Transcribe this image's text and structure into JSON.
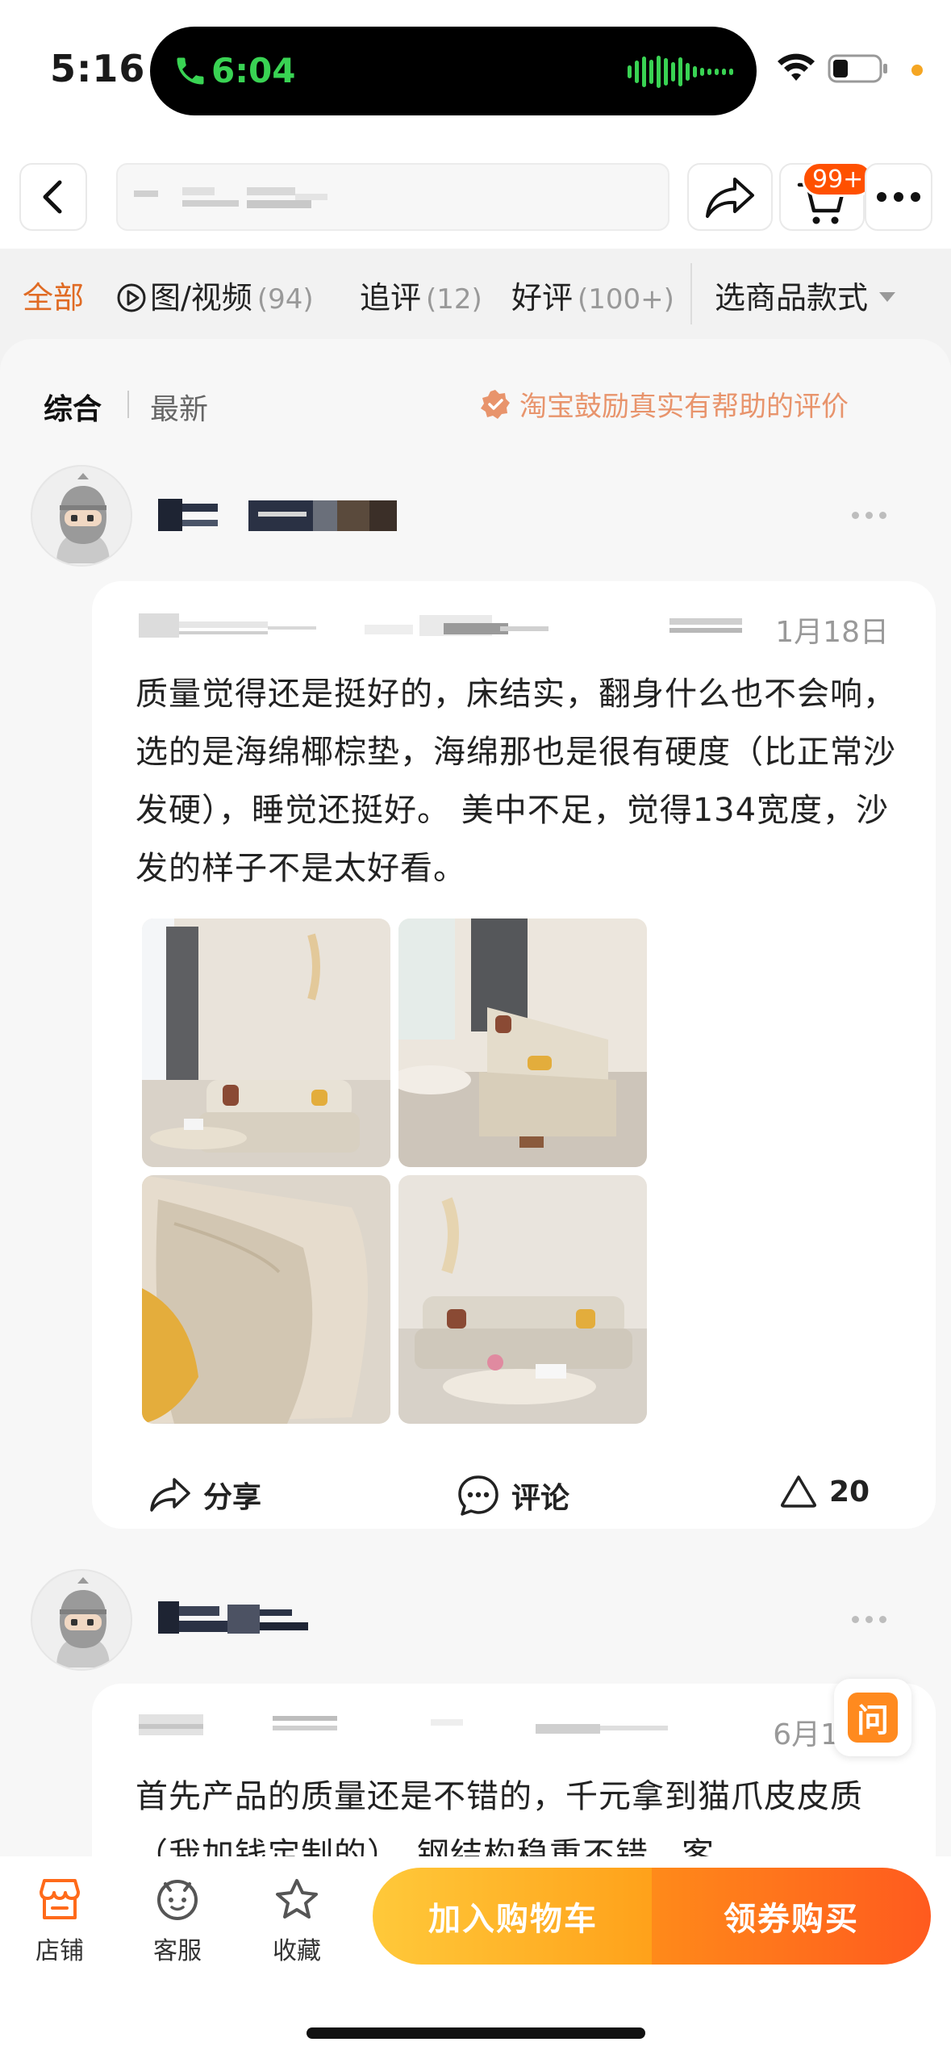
{
  "status_bar": {
    "time": "5:16",
    "call_time": "6:04",
    "icons": [
      "phone-icon",
      "waveform-icon",
      "wifi-icon",
      "battery-icon"
    ]
  },
  "nav": {
    "icons": [
      "back-icon",
      "share-icon",
      "cart-icon",
      "more-icon"
    ],
    "cart_badge": "99+"
  },
  "filters": {
    "tabs": [
      {
        "label": "全部",
        "count": ""
      },
      {
        "label": "图/视频",
        "count": "(94)"
      },
      {
        "label": "追评",
        "count": "(12)"
      },
      {
        "label": "好评",
        "count": "(100+)"
      }
    ],
    "style_select": "选商品款式"
  },
  "sort": {
    "comprehensive": "综合",
    "latest": "最新",
    "encourage": "淘宝鼓励真实有帮助的评价"
  },
  "reviews": [
    {
      "date": "1月18日",
      "content": "质量觉得还是挺好的，床结实，翻身什么也不会响，选的是海绵椰棕垫，海绵那也是很有硬度（比正常沙发硬），睡觉还挺好。 美中不足，觉得134宽度，沙发的样子不是太好看。",
      "actions": {
        "share": "分享",
        "comment": "评论",
        "likes": "20"
      }
    },
    {
      "date": "6月1",
      "content": "首先产品的质量还是不错的，千元拿到猫爪皮皮质（我加钱定制的），钢结构稳重不错，客"
    }
  ],
  "ask_button": "问",
  "bottom_bar": {
    "store": "店铺",
    "service": "客服",
    "favorite": "收藏",
    "add_to_cart": "加入购物车",
    "coupon_buy": "领券购买"
  },
  "colors": {
    "accent": "#e06b24",
    "badge": "#ff5000",
    "cart_gradient": [
      "#ffc93a",
      "#ffa11a"
    ],
    "buy_gradient": [
      "#ff8a1a",
      "#ff5a1e"
    ]
  }
}
